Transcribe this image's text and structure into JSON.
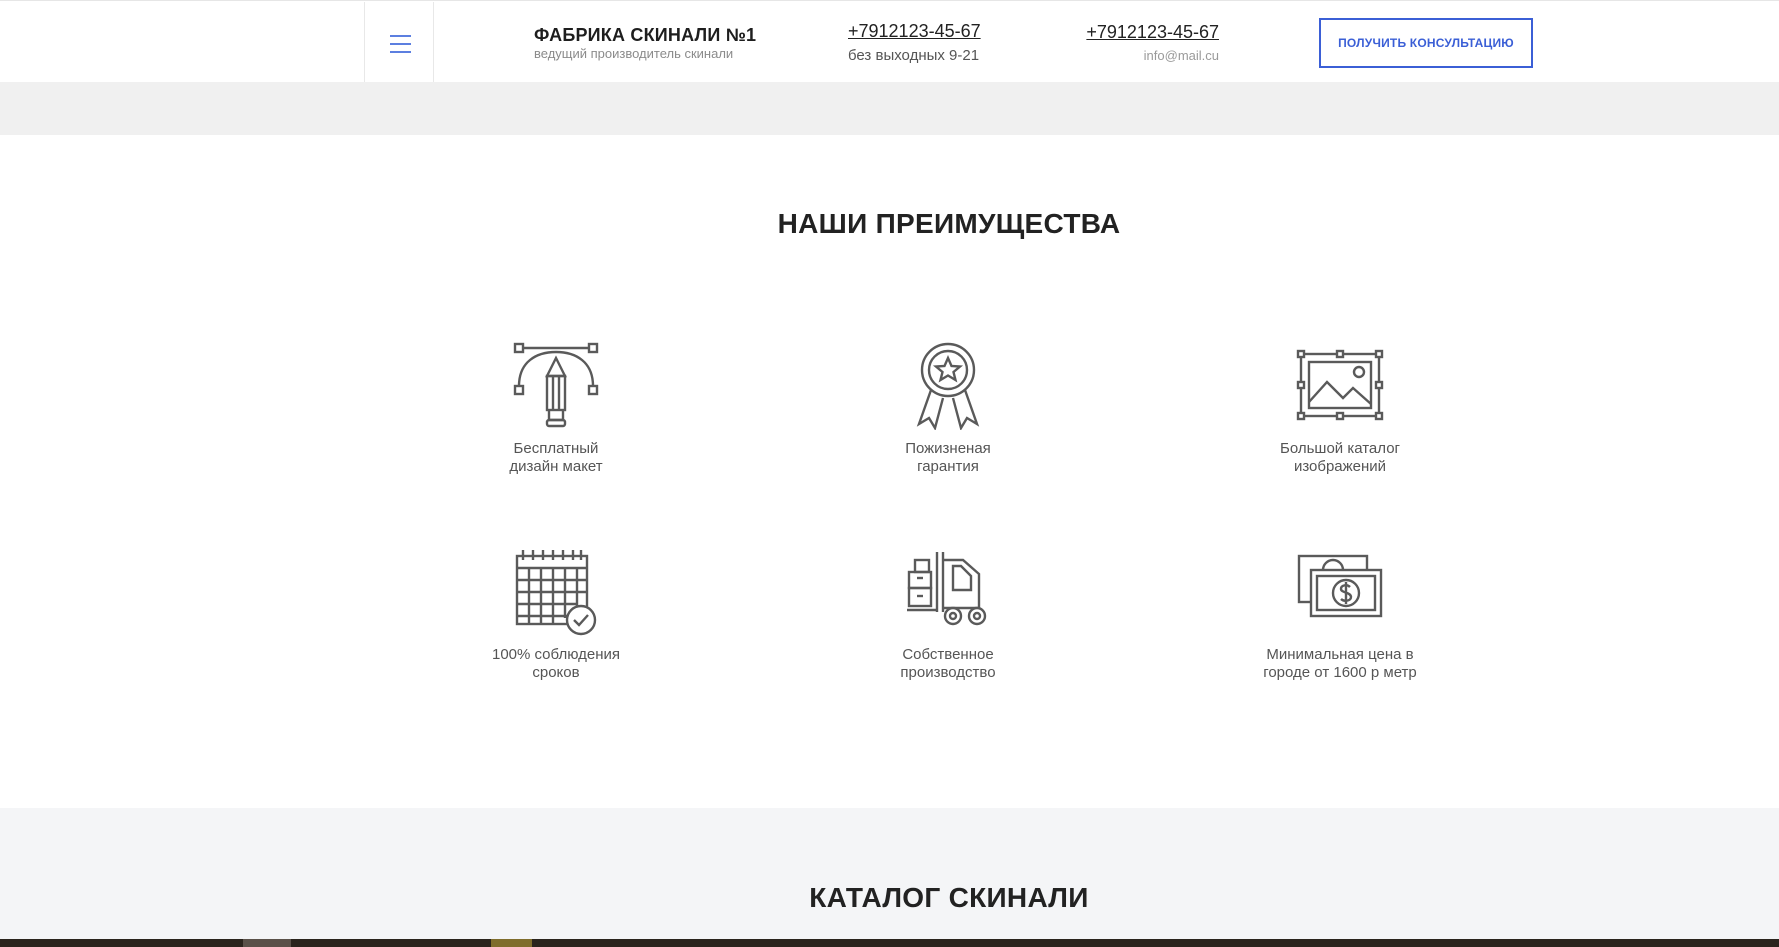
{
  "header": {
    "brand_title": "ФАБРИКА СКИНАЛИ №1",
    "brand_subtitle": "ведущий производитель скинали",
    "phone_primary": "+7912123-45-67",
    "working_hours": "без выходных 9-21",
    "phone_secondary": "+7912123-45-67",
    "email": "info@mail.cu",
    "cta_label": "ПОЛУЧИТЬ КОНСУЛЬТАЦИЮ",
    "menu_icon": "hamburger-icon",
    "accent_color": "#3b5fd6"
  },
  "advantages": {
    "title": "НАШИ ПРЕИМУЩЕСТВА",
    "items": [
      {
        "icon": "pencil-vector-icon",
        "label": "Бесплатный\nдизайн макет"
      },
      {
        "icon": "award-medal-icon",
        "label": "Пожизненая\nгарантия"
      },
      {
        "icon": "image-gallery-icon",
        "label": "Большой каталог\nизображений"
      },
      {
        "icon": "calendar-check-icon",
        "label": "100% соблюдения\nсроков"
      },
      {
        "icon": "forklift-icon",
        "label": "Собственное\nпроизводство"
      },
      {
        "icon": "money-icon",
        "label": "Минимальная цена в\nгороде от 1600 р метр"
      }
    ]
  },
  "catalog": {
    "title": "КАТАЛОГ СКИНАЛИ"
  }
}
